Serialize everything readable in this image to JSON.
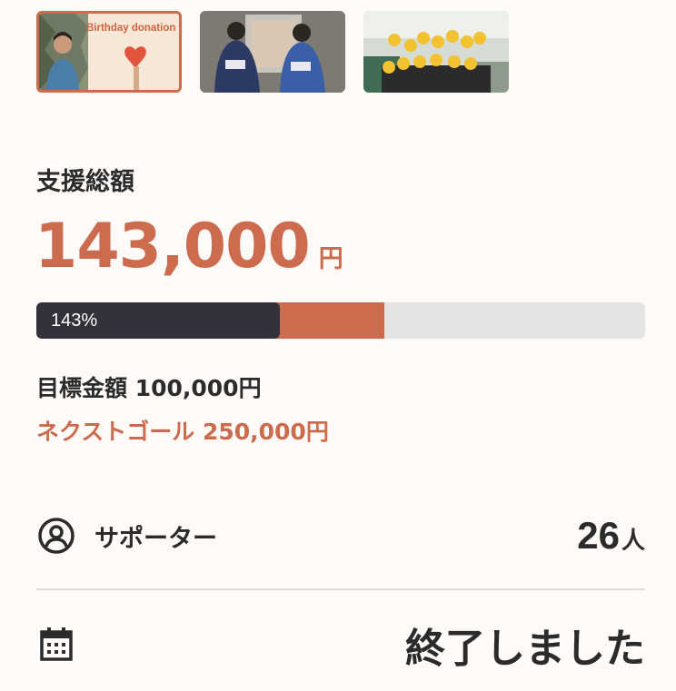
{
  "thumbnails": [
    {
      "caption": "Birthday donation",
      "active": true
    },
    {
      "caption": "",
      "active": false
    },
    {
      "caption": "",
      "active": false
    }
  ],
  "funding": {
    "label": "支援総額",
    "amount": "143,000",
    "unit": "円",
    "progress_label": "143%",
    "progress_percent": 143,
    "goal_text": "目標金額 100,000円",
    "next_goal_text": "ネクストゴール 250,000円",
    "goal_amount": 100000,
    "next_goal_amount": 250000,
    "raised_amount": 143000
  },
  "supporters": {
    "icon": "user-circle-icon",
    "label": "サポーター",
    "count": "26",
    "unit": "人"
  },
  "status": {
    "icon": "calendar-icon",
    "text": "終了しました"
  },
  "colors": {
    "accent": "#cc6b4d",
    "progress_dark": "#33323a",
    "track": "#e4e4e4"
  }
}
